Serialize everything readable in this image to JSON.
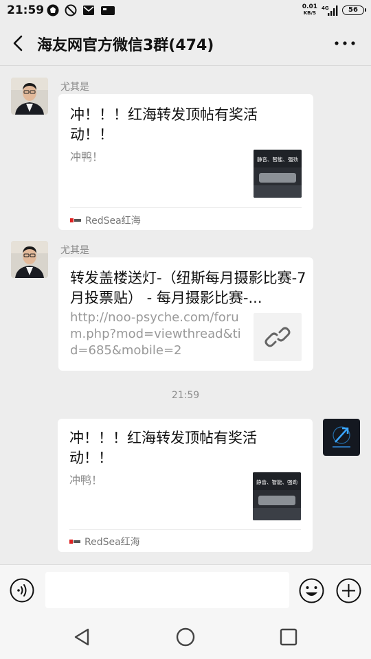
{
  "status_bar": {
    "time": "21:59",
    "net_speed": "0.01",
    "net_unit": "KB/S",
    "signal": "4G",
    "battery": "56"
  },
  "header": {
    "title": "海友网官方微信3群(474)"
  },
  "messages": [
    {
      "sender": "尤其是",
      "card_title": "冲！！！红海转发顶帖有奖活动！！",
      "card_desc": "冲鸭！",
      "thumb_text": "静音、智能、强劲",
      "source": "RedSea红海"
    },
    {
      "sender": "尤其是",
      "card_title": "转发盖楼送灯-（纽斯每月摄影比赛-7月投票贴） - 每月摄影比赛-...",
      "card_desc": "http://noo-psyche.com/forum.php?mod=viewthread&tid=685&mobile=2"
    },
    {
      "timestamp": "21:59"
    },
    {
      "card_title": "冲！！！红海转发顶帖有奖活动！！",
      "card_desc": "冲鸭！",
      "thumb_text": "静音、智能、强劲",
      "source": "RedSea红海"
    }
  ],
  "icons": {
    "back": "chevron-left-icon",
    "more": "more-dots-icon",
    "voice": "voice-icon",
    "emoji": "emoji-icon",
    "plus": "plus-icon",
    "link": "link-icon"
  },
  "colors": {
    "background": "#ededed",
    "bubble": "#ffffff",
    "secondary_text": "#8a8a8a"
  }
}
